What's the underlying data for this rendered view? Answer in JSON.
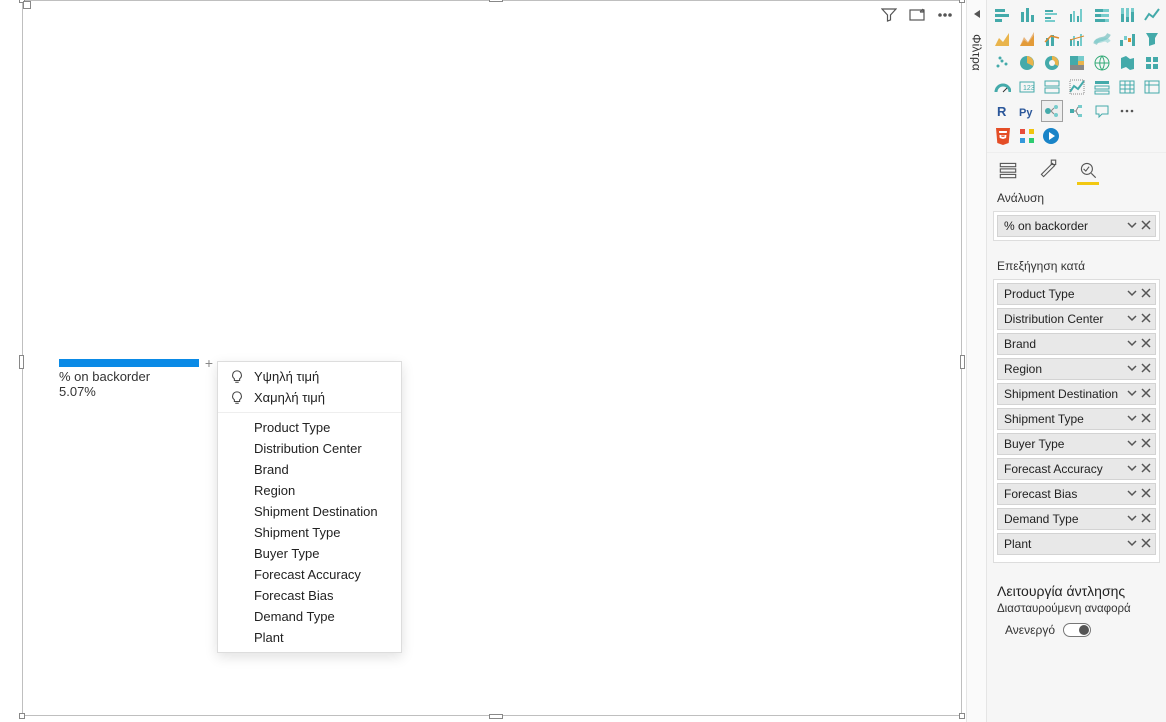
{
  "visual": {
    "label": "% on backorder",
    "value": "5.07%"
  },
  "context_menu": {
    "high": "Υψηλή τιμή",
    "low": "Χαμηλή τιμή",
    "fields": [
      "Product Type",
      "Distribution Center",
      "Brand",
      "Region",
      "Shipment Destination",
      "Shipment Type",
      "Buyer Type",
      "Forecast Accuracy",
      "Forecast Bias",
      "Demand Type",
      "Plant"
    ]
  },
  "filters_rail": {
    "label": "Φίλτρα"
  },
  "panel": {
    "tab_label": "Ανάλυση",
    "analyze_field": "% on backorder",
    "explain_by_label": "Επεξήγηση κατά",
    "explain_by": [
      "Product Type",
      "Distribution Center",
      "Brand",
      "Region",
      "Shipment Destination",
      "Shipment Type",
      "Buyer Type",
      "Forecast Accuracy",
      "Forecast Bias",
      "Demand Type",
      "Plant"
    ],
    "drill_header": "Λειτουργία άντλησης",
    "drill_sub": "Διασταυρούμενη αναφορά",
    "toggle_label": "Ανενεργό"
  }
}
